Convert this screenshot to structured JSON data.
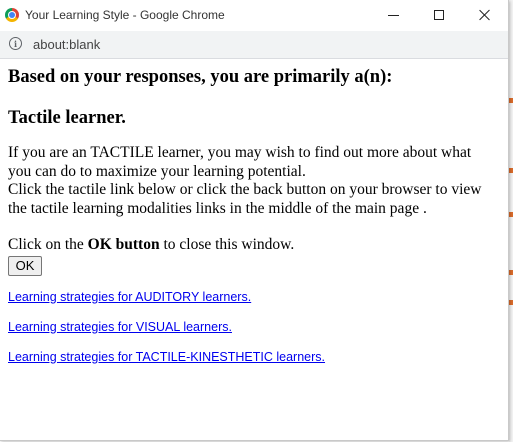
{
  "window": {
    "title": "Your Learning Style - Google Chrome",
    "url": "about:blank"
  },
  "page": {
    "heading": "Based on your responses, you are primarily a(n):",
    "result": "Tactile learner.",
    "paragraph_lines": [
      "If you are an TACTILE learner, you may wish to find out more about what",
      "you can do to maximize your learning potential.",
      "Click the tactile link below or click the back button on your browser to view",
      "the tactile learning modalities links in the middle of the main page ."
    ],
    "close_prefix": "Click on the ",
    "close_bold": "OK button",
    "close_suffix": " to close this window.",
    "ok_label": "OK",
    "links": [
      "Learning strategies for AUDITORY learners.",
      "Learning strategies for VISUAL learners.",
      "Learning strategies for TACTILE-KINESTHETIC learners."
    ]
  },
  "colors": {
    "link": "#0000ee",
    "addressbar_bg": "#f1f3f4"
  },
  "icons": [
    "chrome-logo-icon",
    "minimize-icon",
    "maximize-icon",
    "close-icon",
    "info-icon"
  ]
}
